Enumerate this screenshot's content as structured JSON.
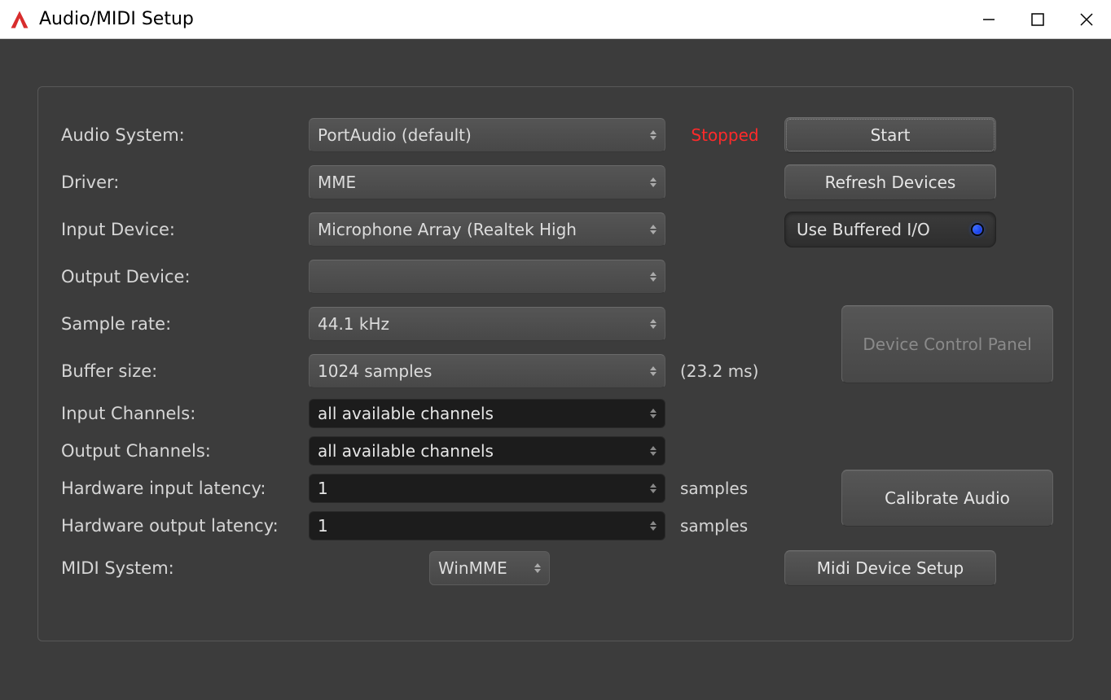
{
  "window": {
    "title": "Audio/MIDI Setup"
  },
  "labels": {
    "audio_system": "Audio System:",
    "driver": "Driver:",
    "input_device": "Input Device:",
    "output_device": "Output Device:",
    "sample_rate": "Sample rate:",
    "buffer_size": "Buffer size:",
    "input_channels": "Input Channels:",
    "output_channels": "Output Channels:",
    "hw_input_latency": "Hardware input latency:",
    "hw_output_latency": "Hardware output latency:",
    "midi_system": "MIDI System:"
  },
  "values": {
    "audio_system": "PortAudio (default)",
    "driver": "MME",
    "input_device": "Microphone Array (Realtek High",
    "output_device": "",
    "sample_rate": "44.1 kHz",
    "buffer_size": "1024 samples",
    "buffer_ms": "(23.2 ms)",
    "input_channels": "all available channels",
    "output_channels": "all available channels",
    "hw_input_latency": "1",
    "hw_output_latency": "1",
    "latency_unit": "samples",
    "midi_system": "WinMME"
  },
  "status": "Stopped",
  "buttons": {
    "start": "Start",
    "refresh": "Refresh Devices",
    "buffered_io": "Use Buffered I/O",
    "device_panel": "Device Control Panel",
    "calibrate": "Calibrate Audio",
    "midi_setup": "Midi Device Setup"
  }
}
